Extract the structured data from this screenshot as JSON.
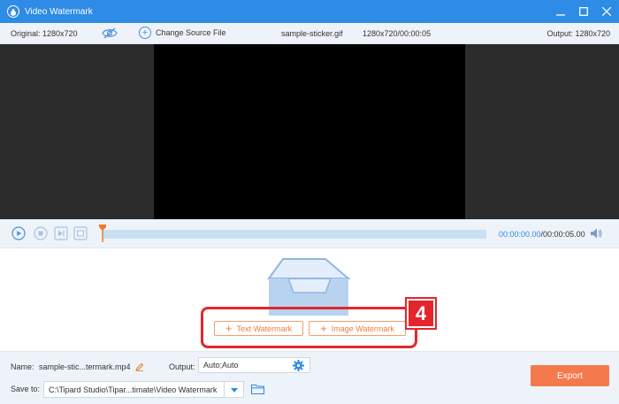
{
  "window": {
    "title": "Video Watermark"
  },
  "infobar": {
    "original": "Original: 1280x720",
    "change_source": "Change Source File",
    "file_name": "sample-sticker.gif",
    "file_info": "1280x720/00:00:05",
    "output_res": "Output: 1280x720"
  },
  "player": {
    "current_time": "00:00:00.00",
    "total_time": "/00:00:05.00"
  },
  "watermark": {
    "text_button": "Text Watermark",
    "image_button": "Image Watermark",
    "step_number": "4"
  },
  "bottom": {
    "name_label": "Name:",
    "name_value": "sample-stic...termark.mp4",
    "output_label": "Output:",
    "output_value": "Auto;Auto",
    "save_label": "Save to:",
    "save_path": "C:\\Tipard Studio\\Tipar...timate\\Video Watermark",
    "export_label": "Export"
  },
  "colors": {
    "accent": "#2e8be6",
    "export": "#f47a4e",
    "watermark_btn": "#f07c3c",
    "highlight": "#e4262c"
  },
  "icons": [
    "app-drop-icon",
    "minimize-icon",
    "maximize-icon",
    "close-icon",
    "eye-icon",
    "add-circle-icon",
    "play-icon",
    "stop-icon",
    "next-frame-icon",
    "snapshot-icon",
    "playhead-icon",
    "volume-icon",
    "edit-pencil-icon",
    "gear-icon",
    "chevron-down-icon",
    "folder-icon"
  ]
}
